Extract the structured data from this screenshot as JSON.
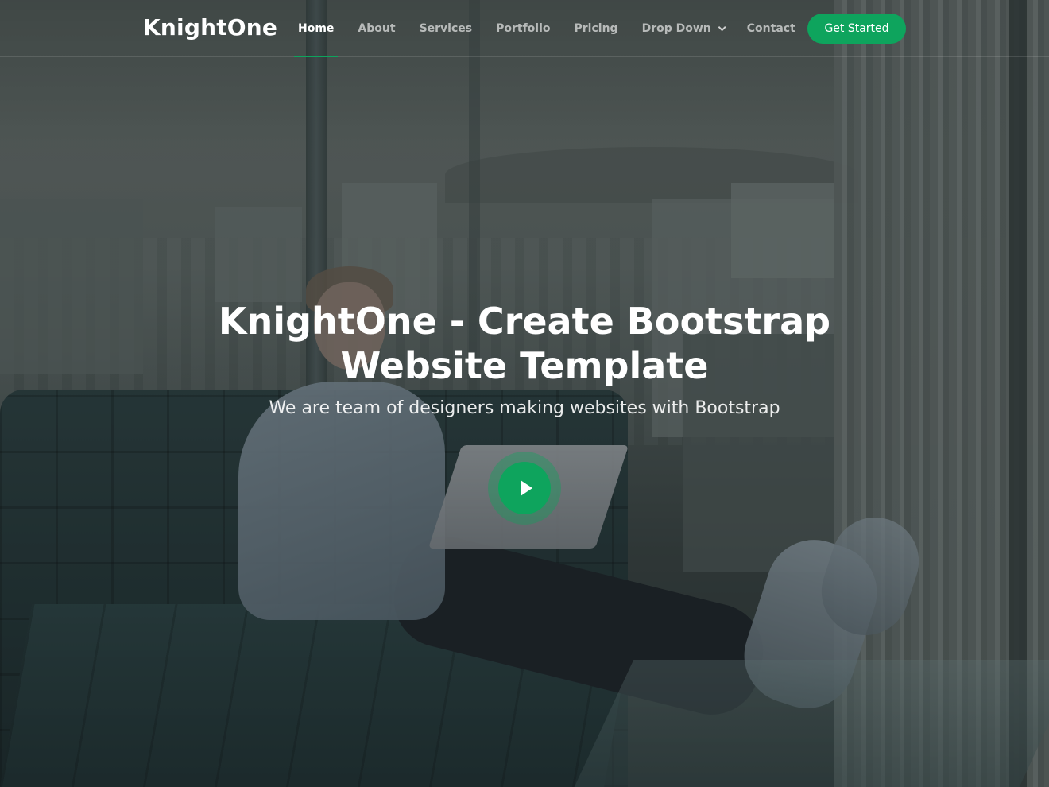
{
  "brand": {
    "logo": "KnightOne"
  },
  "nav": {
    "items": [
      {
        "label": "Home",
        "active": true
      },
      {
        "label": "About"
      },
      {
        "label": "Services"
      },
      {
        "label": "Portfolio"
      },
      {
        "label": "Pricing"
      },
      {
        "label": "Drop Down",
        "has_dropdown": true
      },
      {
        "label": "Contact"
      }
    ],
    "cta_label": "Get Started"
  },
  "hero": {
    "title_line1": "KnightOne - Create Bootstrap",
    "title_line2": "Website Template",
    "subtitle": "We are team of designers making websites with Bootstrap",
    "play_icon": "play-icon"
  },
  "colors": {
    "accent": "#0ea45d",
    "text": "#ffffff"
  }
}
